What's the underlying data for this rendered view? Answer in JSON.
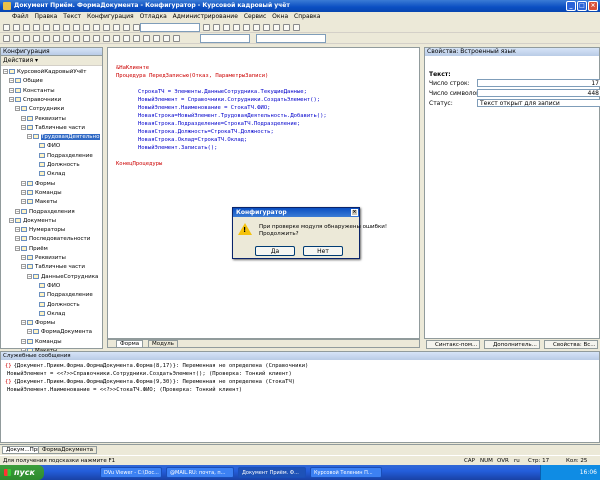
{
  "window": {
    "title": "Документ Приём. ФормаДокумента - Конфигуратор - Курсовой кадровый учёт"
  },
  "menu": [
    "Файл",
    "Правка",
    "Текст",
    "Конфигурация",
    "Отладка",
    "Администрирование",
    "Сервис",
    "Окна",
    "Справка"
  ],
  "left_panel": {
    "header": "Конфигурация",
    "actions_label": "Действия",
    "tree": [
      {
        "label": "КурсовойКадровыйУчёт",
        "level": 0
      },
      {
        "label": "Общие",
        "level": 1
      },
      {
        "label": "Константы",
        "level": 1
      },
      {
        "label": "Справочники",
        "level": 1
      },
      {
        "label": "Сотрудники",
        "level": 2
      },
      {
        "label": "Реквизиты",
        "level": 3
      },
      {
        "label": "Табличные части",
        "level": 3
      },
      {
        "label": "ТрудоваяДеятельно",
        "level": 4,
        "selected": true
      },
      {
        "label": "ФИО",
        "level": 5
      },
      {
        "label": "Подразделение",
        "level": 5
      },
      {
        "label": "Должность",
        "level": 5
      },
      {
        "label": "Оклад",
        "level": 5
      },
      {
        "label": "Формы",
        "level": 3
      },
      {
        "label": "Команды",
        "level": 3
      },
      {
        "label": "Макеты",
        "level": 3
      },
      {
        "label": "Подразделения",
        "level": 2
      },
      {
        "label": "Документы",
        "level": 1
      },
      {
        "label": "Нумераторы",
        "level": 2
      },
      {
        "label": "Последовательности",
        "level": 2
      },
      {
        "label": "Приём",
        "level": 2
      },
      {
        "label": "Реквизиты",
        "level": 3
      },
      {
        "label": "Табличные части",
        "level": 3
      },
      {
        "label": "ДанныеСотрудника",
        "level": 4
      },
      {
        "label": "ФИО",
        "level": 5
      },
      {
        "label": "Подразделение",
        "level": 5
      },
      {
        "label": "Должность",
        "level": 5
      },
      {
        "label": "Оклад",
        "level": 5
      },
      {
        "label": "Формы",
        "level": 3
      },
      {
        "label": "ФормаДокумента",
        "level": 4
      },
      {
        "label": "Команды",
        "level": 3
      },
      {
        "label": "Макеты",
        "level": 3
      }
    ]
  },
  "editor": {
    "lines": [
      {
        "text": "&НаКлиенте",
        "cls": "c-red",
        "indent": 0
      },
      {
        "text": "Процедура ПередЗаписью(Отказ, ПараметрыЗаписи)",
        "cls": "c-red",
        "indent": 0
      },
      {
        "text": "",
        "cls": "",
        "indent": 0
      },
      {
        "text": "СтрокаТЧ = Элементы.ДанныеСотрудника.ТекущиеДанные;",
        "cls": "c-blue",
        "indent": 1
      },
      {
        "text": "НовыйЭлемент = Справочники.Сотрудники.СоздатьЭлемент();",
        "cls": "c-blue",
        "indent": 1
      },
      {
        "text": "НовыйЭлемент.Наименование = СтокаТЧ.ФИО;",
        "cls": "c-blue",
        "indent": 1
      },
      {
        "text": "НоваяСтрока=НовыйЭлемент.ТрудоваяДеятельность.Добавить();",
        "cls": "c-blue",
        "indent": 1
      },
      {
        "text": "НоваяСтрока.Подразделение=СтрокаТЧ.Подразделение;",
        "cls": "c-blue",
        "indent": 1
      },
      {
        "text": "НоваяСтрока.Должность=СтрокаТЧ.Должность;",
        "cls": "c-blue",
        "indent": 1
      },
      {
        "text": "НоваяСтрока.Оклад=СтрокаТЧ.Оклад;",
        "cls": "c-blue",
        "indent": 1
      },
      {
        "text": "НовыйЭлемент.Записать();",
        "cls": "c-blue",
        "indent": 1
      },
      {
        "text": "",
        "cls": "",
        "indent": 0
      },
      {
        "text": "КонецПроцедуры",
        "cls": "c-red",
        "indent": 0
      }
    ],
    "tabs": [
      "Форма",
      "Модуль"
    ]
  },
  "right_panel": {
    "header": "Свойства: Встроенный язык",
    "section": "Текст:",
    "rows": [
      {
        "label": "Число строк:",
        "value": "17"
      },
      {
        "label": "Число символов:",
        "value": "448"
      },
      {
        "label": "Статус:",
        "value": "Текст открыт для записи"
      }
    ],
    "buttons": [
      "Синтакс-пом...",
      "Дополнитель...",
      "Свойства: Вс..."
    ]
  },
  "dialog": {
    "title": "Конфигуратор",
    "line1": "При проверке модуля обнаружены ошибки!",
    "line2": "Продолжить?",
    "yes": "Да",
    "no": "Нет"
  },
  "messages": {
    "header": "Служебные сообщения",
    "lines": [
      {
        "icon": "{}",
        "text": "{Документ.Прием.Форма.ФормаДокумента.Форма(8,17)}: Переменная не определена (Справочники)"
      },
      {
        "icon": "",
        "text": "    НовыйЭлемент = <<?>>Справочники.Сотрудники.СоздатьЭлемент(); (Проверка: Тонкий клиент)"
      },
      {
        "icon": "{}",
        "text": "{Документ.Прием.Форма.ФормаДокумента.Форма(9,30)}: Переменная не определена (СтокаТЧ)"
      },
      {
        "icon": "",
        "text": "    НовыйЭлемент.Наименование = <<?>>СтокаТЧ.ФИО; (Проверка: Тонкий клиент)"
      }
    ]
  },
  "bottom_tabs": [
    "Докум...Прием",
    "ФормаДокумента"
  ],
  "status": {
    "hint": "Для получения подсказки нажмите F1",
    "cap": "CAP",
    "num": "NUM",
    "ovr": "OVR",
    "lang": "ru",
    "line": "Стр: 17",
    "col": "Кол: 25"
  },
  "taskbar": {
    "start": "пуск",
    "items": [
      "DVu Viewer - C:\\Doc...",
      "@MAIL.RU: почта, п...",
      "Документ Приём. Ф...",
      "Курсовой Теленин П..."
    ],
    "clock": "16:06"
  }
}
